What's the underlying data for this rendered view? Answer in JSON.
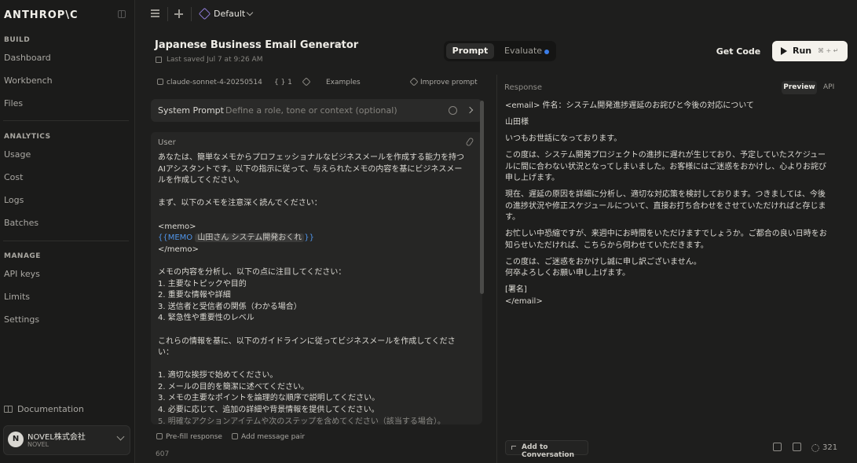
{
  "sidebar": {
    "logo": "ANTHROP\\C",
    "sections": {
      "build": "BUILD",
      "analytics": "ANALYTICS",
      "manage": "MANAGE"
    },
    "build_items": [
      "Dashboard",
      "Workbench",
      "Files"
    ],
    "analytics_items": [
      "Usage",
      "Cost",
      "Logs",
      "Batches"
    ],
    "manage_items": [
      "API keys",
      "Limits",
      "Settings"
    ],
    "documentation": "Documentation",
    "org": {
      "avatar": "N",
      "name": "NOVEL株式会社",
      "sub": "NOVEL"
    }
  },
  "topbar": {
    "project": "Default"
  },
  "header": {
    "title": "Japanese Business Email Generator",
    "saved": "Last saved Jul 7 at 9:26 AM",
    "tabs": {
      "prompt": "Prompt",
      "evaluate": "Evaluate"
    },
    "get_code": "Get Code",
    "run": "Run",
    "run_shortcut": "⌘ + ↵"
  },
  "toolbar": {
    "model": "claude-sonnet-4-20250514",
    "variables": "{ }  1",
    "examples": "Examples",
    "improve": "Improve prompt"
  },
  "system_prompt": {
    "label": "System Prompt",
    "placeholder": "Define a role, tone or context (optional)"
  },
  "user_message": {
    "label": "User",
    "intro_1": "あなたは、簡単なメモからプロフェッショナルなビジネスメールを作成する能力を持つ",
    "intro_2": "AIアシスタントです。以下の指示に従って、与えられたメモの内容を基にビジネスメー",
    "intro_3": "ルを作成してください。",
    "read_memo": "まず、以下のメモを注意深く読んでください：",
    "memo_open": "<memo>",
    "memo_var": "{{MEMO",
    "memo_value": "山田さん システム開発おくれ",
    "memo_var_close": "}}",
    "memo_close": "</memo>",
    "analyze": "メモの内容を分析し、以下の点に注目してください：",
    "points": [
      "1. 主要なトピックや目的",
      "2. 重要な情報や詳細",
      "3. 送信者と受信者の関係（わかる場合）",
      "4. 緊急性や重要性のレベル"
    ],
    "guideline_1": "これらの情報を基に、以下のガイドラインに従ってビジネスメールを作成してくださ",
    "guideline_2": "い：",
    "rules": [
      "1. 適切な挨拶で始めてください。",
      "2. メールの目的を簡潔に述べてください。",
      "3. メモの主要なポイントを論理的な順序で説明してください。",
      "4. 必要に応じて、追加の詳細や背景情報を提供してください。",
      "5. 明確なアクションアイテムや次のステップを含めてください（該当する場合）。"
    ]
  },
  "bottom": {
    "prefill": "Pre-fill response",
    "add_pair": "Add message pair",
    "tokens": "607"
  },
  "response": {
    "label": "Response",
    "preview": "Preview",
    "api": "API",
    "subject": "<email> 件名：システム開発進捗遅延のお詫びと今後の対応について",
    "greeting": "山田様",
    "p1": "いつもお世話になっております。",
    "p2_1": "この度は、システム開発プロジェクトの進捗に遅れが生じており、予定していたスケジュー",
    "p2_2": "ルに間に合わない状況となってしまいました。お客様にはご迷惑をおかけし、心よりお詫び",
    "p2_3": "申し上げます。",
    "p3_1": "現在、遅延の原因を詳細に分析し、適切な対応策を検討しております。つきましては、今後",
    "p3_2": "の進捗状況や修正スケジュールについて、直接お打ち合わせをさせていただければと存じま",
    "p3_3": "す。",
    "p4_1": "お忙しい中恐縮ですが、来週中にお時間をいただけますでしょうか。ご都合の良い日時をお",
    "p4_2": "知らせいただければ、こちらから伺わせていただきます。",
    "p5_1": "この度は、ご迷惑をおかけし誠に申し訳ございません。",
    "p5_2": "何卒よろしくお願い申し上げます。",
    "sign": "[署名]",
    "close": "</email>",
    "add_to_conversation": "Add to Conversation",
    "tokens": "321"
  },
  "colors": {
    "accent_blue": "#3b7de8",
    "variable_blue": "#4f94e8",
    "run_bg": "#f4f2ec"
  }
}
